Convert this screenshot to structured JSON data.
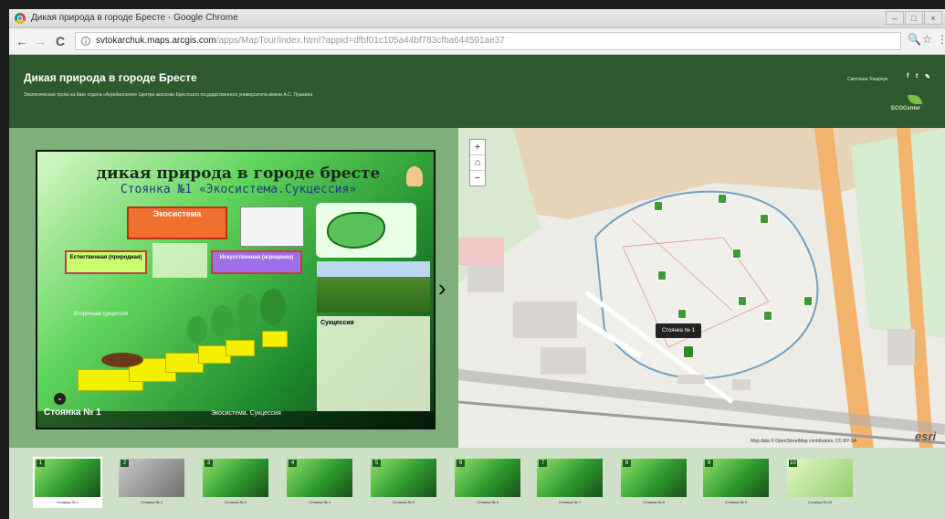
{
  "window": {
    "title": "Дикая природа в городе Бресте - Google Chrome",
    "controls": [
      "–",
      "□",
      "×"
    ]
  },
  "address_bar": {
    "url_host": "svtokarchuk.maps.arcgis.com",
    "url_path": "/apps/MapTour/index.html?appid=dfbf01c105a44bf783cfba644591ae37",
    "back_icon": "←",
    "forward_icon": "→",
    "reload_icon": "C",
    "info_icon": "i",
    "zoom_icon": "🔍",
    "star_icon": "☆",
    "menu_icon": "⋮"
  },
  "header": {
    "title": "Дикая природа в городе Бресте",
    "subtitle": "Экологическая тропа на базе отдела «Агробиология» Центра экологии Брестского государственного университета имени А.С. Пушкина",
    "author": "Светлана Токарчук",
    "social": [
      "f",
      "t",
      "✎"
    ],
    "logo_text": "ECOCenter"
  },
  "poster": {
    "title": "дикая природа в городе бресте",
    "subtitle": "Стоянка №1 «Экосистема.Сукцессия»",
    "ecosystem_label": "Экосистема",
    "natural_label": "Естественная (природная)",
    "artificial_label": "Искусственная (агроценоз)",
    "succession_label": "Вторичная сукцессия",
    "succession_text": "Сукцессия",
    "stop_label": "Стоянка № 1",
    "stop_topic": "Экосистема. Сукцессия"
  },
  "map": {
    "zoom_in": "+",
    "home": "⌂",
    "zoom_out": "−",
    "tooltip": "Стоянка № 1",
    "attribution": "Map data © OpenStreetMap contributors, CC-BY-SA",
    "esri": "esri"
  },
  "carousel": [
    {
      "num": "1",
      "label": "Стоянка № 1"
    },
    {
      "num": "2",
      "label": "Стоянка № 2"
    },
    {
      "num": "3",
      "label": "Стоянка № 3"
    },
    {
      "num": "4",
      "label": "Стоянка № 4"
    },
    {
      "num": "5",
      "label": "Стоянка № 5"
    },
    {
      "num": "6",
      "label": "Стоянка № 6"
    },
    {
      "num": "7",
      "label": "Стоянка № 7"
    },
    {
      "num": "8",
      "label": "Стоянка № 8"
    },
    {
      "num": "9",
      "label": "Стоянка № 9"
    },
    {
      "num": "10",
      "label": "Стоянка № 10"
    }
  ],
  "colors": {
    "header_bg": "#2f5a2f",
    "panel_bg": "#7fb07b",
    "carousel_bg": "#cfe0c8",
    "pin": "#3f9b34"
  }
}
